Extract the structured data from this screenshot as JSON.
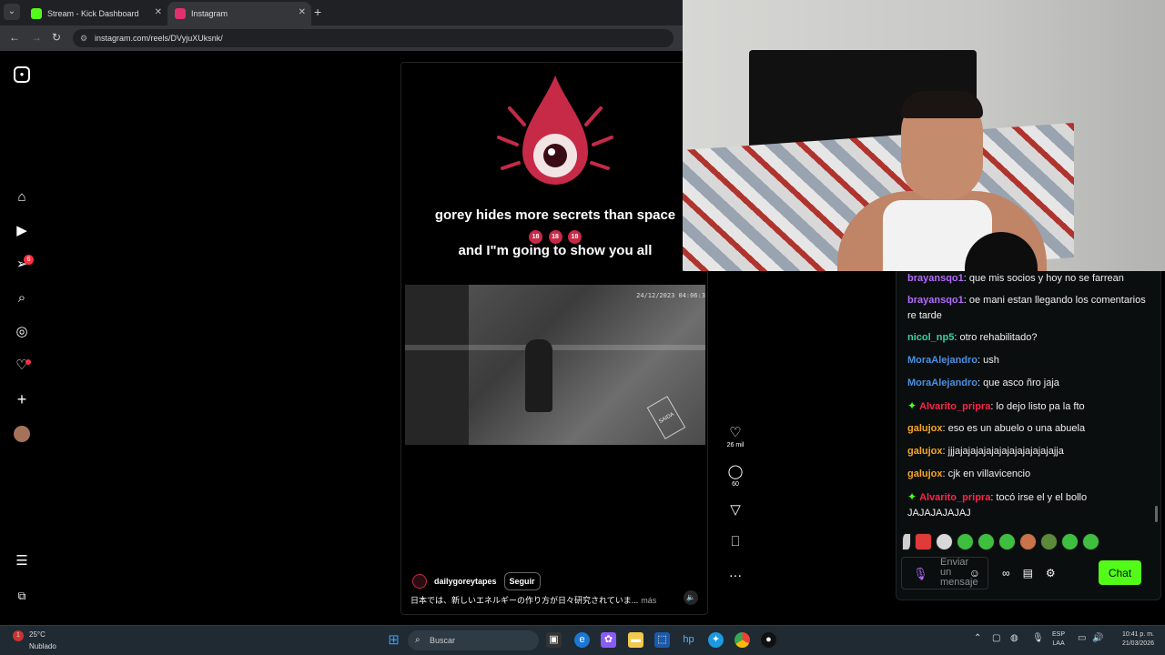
{
  "browser": {
    "tabs": [
      {
        "title": "Stream - Kick Dashboard",
        "favicon_color": "#53fc18"
      },
      {
        "title": "Instagram",
        "favicon_color": "#e1306c"
      }
    ],
    "url": "instagram.com/reels/DVyjuXUksnk/"
  },
  "instagram": {
    "sidebar_icons": [
      "instagram-logo-icon",
      "home-icon",
      "reels-icon",
      "direct-messages-icon",
      "search-icon",
      "explore-icon",
      "notifications-icon",
      "create-icon",
      "profile-avatar-icon",
      "menu-icon",
      "more-apps-icon"
    ],
    "messages_badge": "6",
    "reel": {
      "caption_line1": "gorey hides more secrets than space",
      "caption_emoji": [
        "18",
        "18",
        "18"
      ],
      "caption_line2": "and I\"m going to show you all",
      "cctv_timestamp": "24/12/2023 04:06:3",
      "cctv_sign": "SAIDA",
      "username": "dailygoreytapes",
      "follow_label": "Seguir",
      "description": "日本では、新しいエネルギーの作り方が日々研究されていま...",
      "more_label": "más",
      "likes": "26 mil",
      "comments": "60"
    }
  },
  "chat": {
    "messages": [
      {
        "user": "brayansqo1",
        "color": "purple",
        "text": ": que mis socios y hoy no se farrean"
      },
      {
        "user": "brayansqo1",
        "color": "purple",
        "text": ": oe mani estan llegando los comentarios re tarde"
      },
      {
        "user": "nicol_np5",
        "color": "teal",
        "text": ": otro rehabilitado?"
      },
      {
        "user": "MoraAlejandro",
        "color": "blue",
        "text": ": ush"
      },
      {
        "user": "MoraAlejandro",
        "color": "blue",
        "text": ": que asco ñro jaja"
      },
      {
        "user": "Alvarito_pripra",
        "color": "red",
        "text": ": lo dejo listo pa la fto",
        "badge": true
      },
      {
        "user": "galujox",
        "color": "gold",
        "text": ": eso es un abuelo o una abuela"
      },
      {
        "user": "galujox",
        "color": "gold",
        "text": ": jjjajajajajajajajajajajajajajja"
      },
      {
        "user": "galujox",
        "color": "gold",
        "text": ": cjk en villavicencio"
      },
      {
        "user": "Alvarito_pripra",
        "color": "red",
        "text": ": tocó irse el y el bollo JAJAJAJAJAJ",
        "badge": true
      }
    ],
    "input_placeholder": "Enviar un mensaje",
    "send_label": "Chat",
    "colors": {
      "accent": "#53fc18",
      "purple": "#b46cff",
      "teal": "#36d2a3",
      "blue": "#4a90e2",
      "red": "#ff2448",
      "gold": "#f5a623"
    }
  },
  "taskbar": {
    "weather_temp": "25°C",
    "weather_desc": "Nublado",
    "weather_badge": "1",
    "search_placeholder": "Buscar",
    "lang_line1": "ESP",
    "lang_line2": "LAA",
    "time": "10:41 p. m.",
    "date": "21/03/2026"
  }
}
